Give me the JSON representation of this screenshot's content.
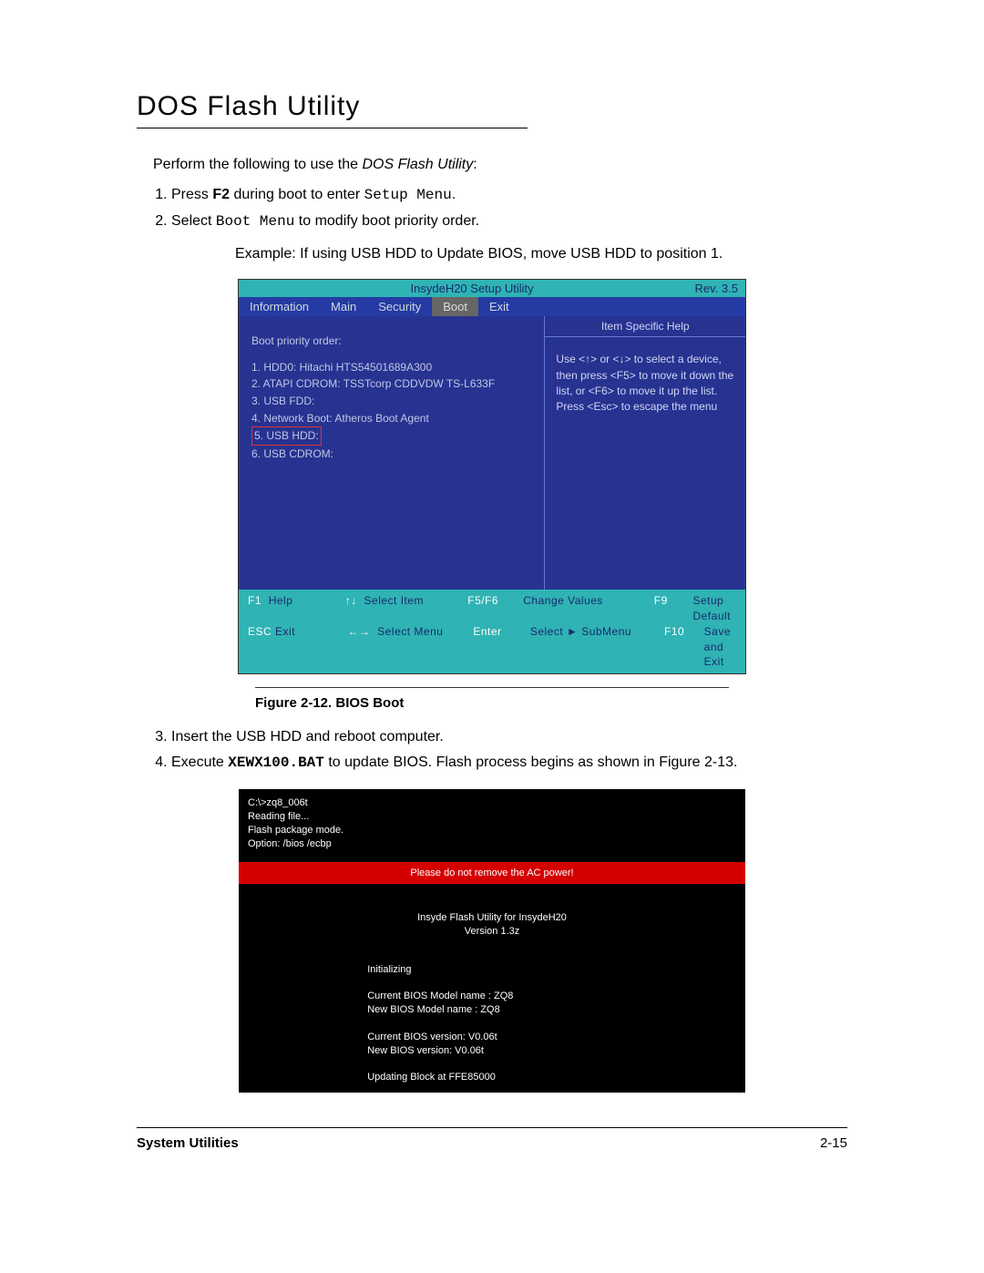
{
  "title": "DOS Flash Utility",
  "intro_prefix": "Perform the following to use the ",
  "intro_em": "DOS Flash Utility",
  "intro_suffix": ":",
  "step1_a": "Press ",
  "step1_b": "F2",
  "step1_c": " during boot to enter ",
  "step1_d": "Setup Menu",
  "step1_e": ".",
  "step2_a": "Select ",
  "step2_b": "Boot Menu",
  "step2_c": " to modify boot priority order.",
  "example": "Example: If using USB HDD to Update BIOS, move USB HDD to position 1.",
  "bios_top_center": "InsydeH20 Setup Utility",
  "bios_top_right": "Rev. 3.5",
  "tabs": {
    "information": "Information",
    "main": "Main",
    "security": "Security",
    "boot": "Boot",
    "exit": "Exit"
  },
  "boot_priority_label": "Boot priority order:",
  "boot_items": {
    "i1": "1. HDD0: Hitachi HTS54501689A300",
    "i2": "2. ATAPI CDROM: TSSTcorp CDDVDW TS-L633F",
    "i3": "3. USB FDD:",
    "i4": "4. Network Boot: Atheros Boot Agent",
    "i5": "5. USB HDD:",
    "i6": "6. USB CDROM:"
  },
  "help_title": "Item Specific Help",
  "help_text": "Use <↑> or <↓> to select a device, then press <F5> to move it down the list, or <F6> to move it up the list. Press <Esc> to escape the menu",
  "bf": {
    "f1": "F1",
    "help": "Help",
    "arrows_v": "↑↓",
    "select_item": "Select Item",
    "f5f6": "F5/F6",
    "change_values": "Change Values",
    "f9": "F9",
    "setup_default": "Setup Default",
    "esc": "ESC",
    "exit": "Exit",
    "arrows_h": "←→",
    "select_menu": "Select Menu",
    "enter": "Enter",
    "select_submenu": "Select ► SubMenu",
    "f10": "F10",
    "save_exit": "Save and Exit"
  },
  "figcap": "Figure 2-12.   BIOS Boot",
  "step3": "Insert the USB HDD and reboot computer.",
  "step4_a": "Execute ",
  "step4_b": "XEWX100.BAT",
  "step4_c": " to update BIOS. Flash process begins as shown in Figure 2-13.",
  "flash_head": {
    "l1": "C:\\>zq8_006t",
    "l2": "Reading file...",
    "l3": "Flash package mode.",
    "l4": "Option: /bios /ecbp"
  },
  "flash_warn": "Please do not remove the AC power!",
  "flash_center1": "Insyde Flash Utility for InsydeH20",
  "flash_center2": "Version 1.3z",
  "flash_init": "Initializing",
  "flash_cur_model": "Current BIOS Model name : ZQ8",
  "flash_new_model": "New     BIOS Model name : ZQ8",
  "flash_cur_ver": "Current BIOS version: V0.06t",
  "flash_new_ver": "New     BIOS version: V0.06t",
  "flash_updating": "Updating Block at FFE85000",
  "footer_left": "System Utilities",
  "footer_right": "2-15"
}
